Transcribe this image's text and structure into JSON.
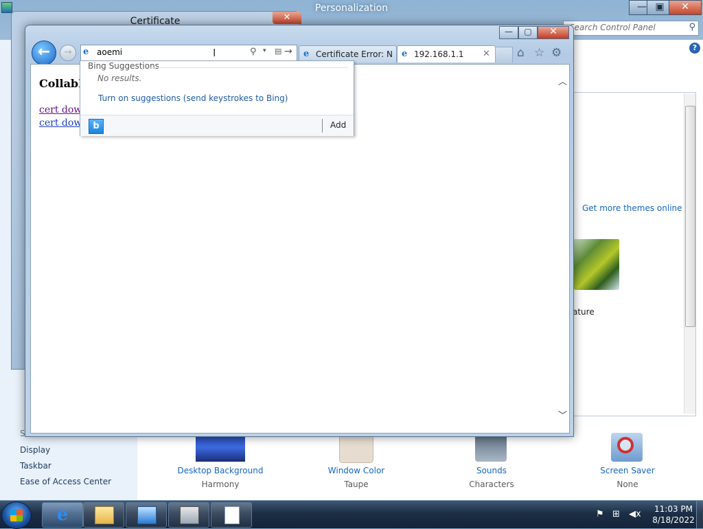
{
  "personalization": {
    "title": "Personalization",
    "controls": {
      "minimize": "—",
      "maximize": "▣",
      "close": "✕"
    },
    "search_placeholder": "Search Control Panel",
    "search_icon": "magnifier-icon",
    "help": "?",
    "get_more_themes": "Get more themes online",
    "theme_label": "ature",
    "see_also_heading": "S",
    "see_also": [
      "Display",
      "Taskbar",
      "Ease of Access Center"
    ],
    "bottom_items": [
      {
        "label": "Desktop Background",
        "sub": "Harmony"
      },
      {
        "label": "Window Color",
        "sub": "Taupe"
      },
      {
        "label": "Sounds",
        "sub": "Characters"
      },
      {
        "label": "Screen Saver",
        "sub": "None"
      }
    ]
  },
  "certificate_dialog": {
    "title": "Certificate",
    "close": "✕"
  },
  "ie": {
    "controls": {
      "minimize": "—",
      "maximize": "▢",
      "close": "✕"
    },
    "back": "←",
    "forward": "→",
    "address": {
      "favicon": "e",
      "value": "aoemi",
      "cursor": "I",
      "search": "⚲",
      "dropdown": "▾",
      "compat": "▤",
      "go": "→"
    },
    "tabs": [
      {
        "icon": "e",
        "title": "Certificate Error: Na..."
      },
      {
        "icon": "e",
        "title": "192.168.1.1",
        "close": "✕"
      }
    ],
    "commands": {
      "home": "⌂",
      "favorites": "☆",
      "tools": "⚙"
    },
    "page": {
      "heading": "CollabN",
      "links": [
        "cert down",
        "cert down"
      ]
    },
    "scroll": {
      "up": "︿",
      "down": "﹀"
    },
    "suggestions": {
      "header": "Bing Suggestions",
      "no_results": "No results.",
      "turn_on": "Turn on suggestions (send keystrokes to Bing)",
      "bing_icon": "b",
      "add": "Add"
    }
  },
  "taskbar": {
    "buttons": [
      "internet-explorer",
      "windows-explorer",
      "control-panel",
      "network",
      "document"
    ],
    "tray": {
      "flag": "⚑",
      "network": "⊞",
      "volume": "◀x"
    },
    "clock": {
      "time": "11:03 PM",
      "date": "8/18/2022"
    }
  }
}
